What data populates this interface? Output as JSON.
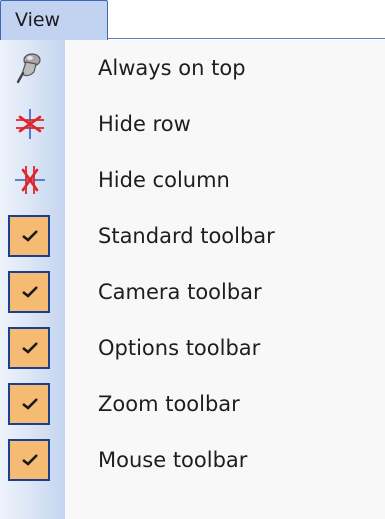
{
  "menubar": {
    "title": "View"
  },
  "menu": {
    "items": [
      {
        "label": "Always on top",
        "icon": "pin-icon",
        "checked": false
      },
      {
        "label": "Hide row",
        "icon": "hide-row-icon",
        "checked": false
      },
      {
        "label": "Hide column",
        "icon": "hide-column-icon",
        "checked": false
      },
      {
        "label": "Standard toolbar",
        "icon": "checkmark-icon",
        "checked": true
      },
      {
        "label": "Camera toolbar",
        "icon": "checkmark-icon",
        "checked": true
      },
      {
        "label": "Options toolbar",
        "icon": "checkmark-icon",
        "checked": true
      },
      {
        "label": "Zoom toolbar",
        "icon": "checkmark-icon",
        "checked": true
      },
      {
        "label": "Mouse toolbar",
        "icon": "checkmark-icon",
        "checked": true
      }
    ]
  },
  "colors": {
    "menu_title_bg": "#c2d3f1",
    "menu_border": "#3f68b8",
    "check_bg": "#f6bb72",
    "check_border": "#1d3f92",
    "icon_red": "#e0242a",
    "icon_blue": "#2f5fc4"
  }
}
